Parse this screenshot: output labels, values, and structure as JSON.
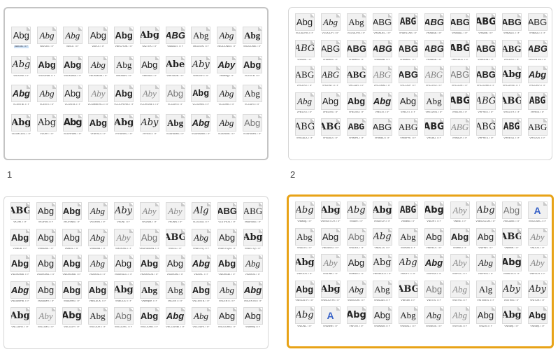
{
  "panels": [
    {
      "id": "1",
      "caption": "1",
      "selection": "gray",
      "rows": [
        [
          {
            "s": "Abg",
            "n": "VAVOB.TTF",
            "st": 0,
            "hl": true
          },
          {
            "s": "Abg",
            "n": "VAVOBI.TTF",
            "st": 2
          },
          {
            "s": "Abg",
            "n": "VAVOI.TTF",
            "st": 2
          },
          {
            "s": "Abg",
            "n": "VAVOI.TTF",
            "st": 0
          },
          {
            "s": "Abg",
            "n": "VBKCHON.TTF",
            "st": 1
          },
          {
            "s": "Abg",
            "n": "VAZTEK.TTF",
            "st": 3
          },
          {
            "s": "ABG",
            "n": "VBANDIT.TTF",
            "st": 7
          },
          {
            "s": "Abg",
            "n": "VBODON.TTF",
            "st": 5
          },
          {
            "s": "Abg",
            "n": "VBODONBI.TTF",
            "st": 2
          },
          {
            "s": "Abg",
            "n": "VBODONB.TTF",
            "st": 10
          }
        ],
        [
          {
            "s": "Abg",
            "n": "VBOONII.TTF",
            "st": 6
          },
          {
            "s": "Abg",
            "n": "VBOONIB.TTF",
            "st": 1
          },
          {
            "s": "Abg",
            "n": "VBOKMAB.TTF",
            "st": 1
          },
          {
            "s": "Abg",
            "n": "VBOKMAIB.TTF",
            "st": 2
          },
          {
            "s": "Abg",
            "n": "VBKMAN.TTF",
            "st": 5
          },
          {
            "s": "Abg",
            "n": "VBKMAI.TTF",
            "st": 0
          },
          {
            "s": "Abe",
            "n": "VBKSADB.TTF",
            "st": 3
          },
          {
            "s": "Aby",
            "n": "VBRUSH.TTF",
            "st": 6
          },
          {
            "s": "Aby",
            "n": "Vbutting.TTF",
            "st": 7
          },
          {
            "s": "Abg",
            "n": "VCENTB.TTF",
            "st": 1
          }
        ],
        [
          {
            "s": "Abg",
            "n": "VCENTBI.TTF",
            "st": 7
          },
          {
            "s": "Abg",
            "n": "VCENTI.TTF",
            "st": 2
          },
          {
            "s": "Abg",
            "n": "VCONTB.TTF",
            "st": 0
          },
          {
            "s": "Aby",
            "n": "VCOMMERCI.TTF",
            "st": 11
          },
          {
            "s": "Abg",
            "n": "VCOOPERB.TTF",
            "st": 1
          },
          {
            "s": "Aby",
            "n": "VCORONET.TTF",
            "st": 11
          },
          {
            "s": "Abg",
            "n": "VCOURI.TTF",
            "st": 12
          },
          {
            "s": "Abg",
            "n": "VCOURBI.TTF",
            "st": 8
          },
          {
            "s": "Abg",
            "n": "VCOURB.TTF",
            "st": 2
          },
          {
            "s": "Abg",
            "n": "VCOURI.TTF",
            "st": 5
          }
        ],
        [
          {
            "s": "Abg",
            "n": "VDOMCASL.TTF",
            "st": 3
          },
          {
            "s": "Abg",
            "n": "VDURY.TTF",
            "st": 13
          },
          {
            "s": "Abg",
            "n": "VDURHAM.TTF",
            "st": 9
          },
          {
            "s": "Abg",
            "n": "VFARSO.TTF",
            "st": 1
          },
          {
            "s": "Abg",
            "n": "VFRANKG.TTF",
            "st": 3
          },
          {
            "s": "Aby",
            "n": "VFREEI.TTF",
            "st": 6
          },
          {
            "s": "Abg",
            "n": "VGARAMB.TTF",
            "st": 10
          },
          {
            "s": "Abg",
            "n": "VGARAMBI.TTF",
            "st": 7
          },
          {
            "s": "Abg",
            "n": "VGARAMI.TTF",
            "st": 2
          },
          {
            "s": "Abg",
            "n": "VGARAMN.TTF",
            "st": 12
          }
        ]
      ]
    },
    {
      "id": "2",
      "caption": "2",
      "selection": "none",
      "rows": [
        [
          {
            "s": "Abg",
            "n": "VGOUDYB.TTF",
            "st": 0
          },
          {
            "s": "Abg",
            "n": "VGOUDYI.TTF",
            "st": 2
          },
          {
            "s": "Abg",
            "n": "VGOUDYN.TTF",
            "st": 5
          },
          {
            "s": "ABG",
            "n": "VHANDEL.TTF",
            "st": 0
          },
          {
            "s": "ABG",
            "n": "VHARLOW.TTF",
            "st": 14
          },
          {
            "s": "ABG",
            "n": "VHABAB.TTF",
            "st": 7
          },
          {
            "s": "ABG",
            "n": "VHABALI.TTF",
            "st": 1
          },
          {
            "s": "ABG",
            "n": "VHABIB.TTF",
            "st": 4
          },
          {
            "s": "ABG",
            "n": "VHBAULI.TTF",
            "st": 1
          },
          {
            "s": "ABG",
            "n": "VHBAULT.TTF",
            "st": 0
          }
        ],
        [
          {
            "s": "ABG",
            "n": "VHABIE.TTF",
            "st": 6
          },
          {
            "s": "ABG",
            "n": "VHAMIN.TTF",
            "st": 0
          },
          {
            "s": "ABG",
            "n": "VHAMIN.TTF",
            "st": 1
          },
          {
            "s": "ABG",
            "n": "VHAMAB.TTF",
            "st": 7
          },
          {
            "s": "ABG",
            "n": "VHAMBC.TTF",
            "st": 1
          },
          {
            "s": "ABG",
            "n": "VHABAB.TTF",
            "st": 7
          },
          {
            "s": "ABG",
            "n": "VHBLACK.TTF",
            "st": 4
          },
          {
            "s": "ABG",
            "n": "VHBODB.TTF",
            "st": 1
          },
          {
            "s": "ABG",
            "n": "VHCENT.TTF",
            "st": 10
          },
          {
            "s": "ABG",
            "n": "VHCENTBI.TTF",
            "st": 7
          }
        ],
        [
          {
            "s": "ABG",
            "n": "VHCENT.TTF",
            "st": 5
          },
          {
            "s": "ABG",
            "n": "VHCENTI.TTF",
            "st": 2
          },
          {
            "s": "ABG",
            "n": "VHCLAR.TTF",
            "st": 10
          },
          {
            "s": "ABG",
            "n": "VHCOMM.TTF",
            "st": 11
          },
          {
            "s": "ABG",
            "n": "VHCOOP.TTF",
            "st": 1
          },
          {
            "s": "ABG",
            "n": "VHCORO.TTF",
            "st": 11
          },
          {
            "s": "ABG",
            "n": "VHCOUR.TTF",
            "st": 12
          },
          {
            "s": "ABG",
            "n": "VHCOURB.TTF",
            "st": 1
          },
          {
            "s": "Abg",
            "n": "VHCURVE.TTF",
            "st": 3
          },
          {
            "s": "Abg",
            "n": "VHCURVI.TTF",
            "st": 7
          }
        ],
        [
          {
            "s": "Abg",
            "n": "VHELVO.TTF",
            "st": 2
          },
          {
            "s": "Abg",
            "n": "VHELVN.TTF",
            "st": 0
          },
          {
            "s": "Abg",
            "n": "VHELVB.TTF",
            "st": 1
          },
          {
            "s": "Abg",
            "n": "VHELVI.TTF",
            "st": 7
          },
          {
            "s": "Abg",
            "n": "VHELVT.TTF",
            "st": 0
          },
          {
            "s": "Abg",
            "n": "VHELVEN.TTF",
            "st": 5
          },
          {
            "s": "ABG",
            "n": "VHELVN.TTF",
            "st": 4
          },
          {
            "s": "ABG",
            "n": "VHFREE.TTF",
            "st": 6
          },
          {
            "s": "ABG",
            "n": "VHGOTH.TTF",
            "st": 3
          },
          {
            "s": "ABG",
            "n": "VHHEB.TTF",
            "st": 14
          }
        ],
        [
          {
            "s": "ABG",
            "n": "VHIGALA.TTF",
            "st": 13
          },
          {
            "s": "ABG",
            "n": "VHIGBO.TTF",
            "st": 3
          },
          {
            "s": "ABG",
            "n": "VHIMPA.TTF",
            "st": 8
          },
          {
            "s": "ABG",
            "n": "VHIMBO.TTF",
            "st": 0
          },
          {
            "s": "ABG",
            "n": "VHIMPRI.TTF",
            "st": 5
          },
          {
            "s": "ABG",
            "n": "VHOBO.TTF",
            "st": 4
          },
          {
            "s": "ABG",
            "n": "VHKAUF.TTF",
            "st": 11
          },
          {
            "s": "ABG",
            "n": "VHPRES.TTF",
            "st": 13
          },
          {
            "s": "ABG",
            "n": "VHRESU.TTF",
            "st": 14
          },
          {
            "s": "ABG",
            "n": "VHSOUV.TTF",
            "st": 5
          }
        ]
      ]
    },
    {
      "id": "3",
      "caption": "",
      "selection": "none",
      "rows": [
        [
          {
            "s": "ABG",
            "n": "VKORI.TTF",
            "st": 3
          },
          {
            "s": "Abg",
            "n": "VKORIN.TTF",
            "st": 0
          },
          {
            "s": "Abg",
            "n": "VKORINB.TTF",
            "st": 1
          },
          {
            "s": "Abg",
            "n": "VKORINI.TTF",
            "st": 2
          },
          {
            "s": "Aby",
            "n": "VKUNI.TTF",
            "st": 6
          },
          {
            "s": "Aby",
            "n": "VKUNIB.TTF",
            "st": 11
          },
          {
            "s": "Aby",
            "n": "VKUNN.TTF",
            "st": 11
          },
          {
            "s": "Alg",
            "n": "VLUCIDA.TTF",
            "st": 6
          },
          {
            "s": "ABG",
            "n": "VLUTHOS.TTF",
            "st": 1
          },
          {
            "s": "ABG",
            "n": "VMARIAB.TTF",
            "st": 5
          }
        ],
        [
          {
            "s": "Abg",
            "n": "VMBUB.TTF",
            "st": 1
          },
          {
            "s": "Abg",
            "n": "VMBUBE.TTF",
            "st": 0
          },
          {
            "s": "Abg",
            "n": "VMBUL.TTF",
            "st": 0
          },
          {
            "s": "Abg",
            "n": "VMBUBB.TTF",
            "st": 2
          },
          {
            "s": "Aby",
            "n": "VMURAN.TTF",
            "st": 11
          },
          {
            "s": "Abg",
            "n": "VMURAMAN.TTF",
            "st": 12
          },
          {
            "s": "ABG",
            "n": "VNIGG.TTF",
            "st": 3
          },
          {
            "s": "Abg",
            "n": "VNASTIQ.TTF",
            "st": 2
          },
          {
            "s": "Abg",
            "n": "VNASTIQB.TTF",
            "st": 0
          },
          {
            "s": "Abg",
            "n": "VNASTIQ.TTF",
            "st": 3
          }
        ],
        [
          {
            "s": "Abg",
            "n": "VNAIRAMB.TTF",
            "st": 1
          },
          {
            "s": "Abg",
            "n": "VNAIRAML.TTF",
            "st": 0
          },
          {
            "s": "Abg",
            "n": "VNAIRAMB.TTF",
            "st": 1
          },
          {
            "s": "Abg",
            "n": "VNAIRALI.TTF",
            "st": 2
          },
          {
            "s": "Abg",
            "n": "VNAIRALO.TTF",
            "st": 0
          },
          {
            "s": "Abg",
            "n": "VNAIRAOB.TTF",
            "st": 1
          },
          {
            "s": "Abg",
            "n": "VNAIRAM.TTF",
            "st": 0
          },
          {
            "s": "Abg",
            "n": "VNAIRL.TTF",
            "st": 7
          },
          {
            "s": "Abg",
            "n": "VNAIRABI.TTF",
            "st": 1
          },
          {
            "s": "Abg",
            "n": "VNAIRAI.TTF",
            "st": 2
          }
        ],
        [
          {
            "s": "Abg",
            "n": "VNAIAMHB.TTF",
            "st": 7
          },
          {
            "s": "Abg",
            "n": "VNAIAMH.TTF",
            "st": 0
          },
          {
            "s": "Abg",
            "n": "VNAIAHB.TTF",
            "st": 1
          },
          {
            "s": "Abg",
            "n": "VNBLACK.TTF",
            "st": 1
          },
          {
            "s": "Abg",
            "n": "VNBODO.TTF",
            "st": 3
          },
          {
            "s": "Abg",
            "n": "VNbrique.TTF",
            "st": 10
          },
          {
            "s": "Abg",
            "n": "VNCENT.TTF",
            "st": 5
          },
          {
            "s": "Abg",
            "n": "VNCENTB.TTF",
            "st": 1
          },
          {
            "s": "Abg",
            "n": "VNCENTI.TTF",
            "st": 2
          },
          {
            "s": "Abg",
            "n": "VNCENTBI.TTF",
            "st": 7
          }
        ],
        [
          {
            "s": "Abg",
            "n": "VNCLARE.TTF",
            "st": 3
          },
          {
            "s": "Aby",
            "n": "VNCOMS.TTF",
            "st": 11
          },
          {
            "s": "Abg",
            "n": "VNCOOP.TTF",
            "st": 4
          },
          {
            "s": "Abg",
            "n": "VNCOUR.TTF",
            "st": 5
          },
          {
            "s": "Abg",
            "n": "VNCOURL.TTF",
            "st": 12
          },
          {
            "s": "Abg",
            "n": "VNCOURB.TTF",
            "st": 1
          },
          {
            "s": "Abg",
            "n": "VNCOURBI.TTF",
            "st": 7
          },
          {
            "s": "Abg",
            "n": "VNCOURI.TTF",
            "st": 2
          },
          {
            "s": "Abg",
            "n": "VNCOURB.TTF",
            "st": 0
          },
          {
            "s": "Abg",
            "n": "VNdmny.TTF",
            "st": 0
          }
        ]
      ]
    },
    {
      "id": "4",
      "caption": "",
      "selection": "orange",
      "rows": [
        [
          {
            "s": "Abg",
            "n": "Vnitalog.TTF",
            "st": 6
          },
          {
            "s": "Abg",
            "n": "VNISKETCH.TTF",
            "st": 3
          },
          {
            "s": "Abg",
            "n": "VNIAIR.TTF",
            "st": 6
          },
          {
            "s": "Abg",
            "n": "VNIDECH.TTF",
            "st": 3
          },
          {
            "s": "ABG",
            "n": "VNIdisk.TTF",
            "st": 14
          },
          {
            "s": "Abg",
            "n": "VNIDHT.TTF",
            "st": 4
          },
          {
            "s": "Aby",
            "n": "VNIBE.TTF",
            "st": 11
          },
          {
            "s": "Abg",
            "n": "VNIBOLLON.TTF",
            "st": 6
          },
          {
            "s": "Abg",
            "n": "VNICAME.TTF",
            "st": 12
          },
          {
            "s": "A",
            "n": "VNICOMIC.TTF",
            "st": 15
          }
        ],
        [
          {
            "s": "Abg",
            "n": "VNIDOS.TTF",
            "st": 5
          },
          {
            "s": "Abg",
            "n": "VNIDAVID.TTF",
            "st": 0
          },
          {
            "s": "Abg",
            "n": "VNIDEA.TTF",
            "st": 12
          },
          {
            "s": "Abg",
            "n": "VNIALLS.TTF",
            "st": 6
          },
          {
            "s": "Abg",
            "n": "VNIHAN.TTF",
            "st": 5
          },
          {
            "s": "Abg",
            "n": "VNIHELV.TTF",
            "st": 0
          },
          {
            "s": "Abg",
            "n": "VNIHIB.TTF",
            "st": 1
          },
          {
            "s": "Abg",
            "n": "VNIHNV.TTF",
            "st": 0
          },
          {
            "s": "ABG",
            "n": "VNIbriet.TTF",
            "st": 3
          },
          {
            "s": "Aby",
            "n": "VNIJOE.TTF",
            "st": 11
          }
        ],
        [
          {
            "s": "Abg",
            "n": "VNIKIOS.TTF",
            "st": 3
          },
          {
            "s": "Aby",
            "n": "VNILINK.TTF",
            "st": 11
          },
          {
            "s": "Abg",
            "n": "VNIMUS.TTF",
            "st": 0
          },
          {
            "s": "Abg",
            "n": "VNIRBOLO.TTF",
            "st": 13
          },
          {
            "s": "Abg",
            "n": "VNIOPTI.TTF",
            "st": 6
          },
          {
            "s": "Abg",
            "n": "VNIPISA.TTF",
            "st": 7
          },
          {
            "s": "Aby",
            "n": "VNIPOC.TTF",
            "st": 11
          },
          {
            "s": "Abg",
            "n": "VNIPRIS.TTF",
            "st": 2
          },
          {
            "s": "Abg",
            "n": "VNIREVO.TTF",
            "st": 4
          },
          {
            "s": "Aby",
            "n": "VNIRICH.TTF",
            "st": 11
          }
        ],
        [
          {
            "s": "Abg",
            "n": "VNISOUTH.TTF",
            "st": 1
          },
          {
            "s": "Abg",
            "n": "VNISOUTHI.TTF",
            "st": 3
          },
          {
            "s": "Abg",
            "n": "VNISOURI.TTF",
            "st": 2
          },
          {
            "s": "Abg",
            "n": "VNISUAS.TTF",
            "st": 5
          },
          {
            "s": "ABG",
            "n": "VNISWI.TTF",
            "st": 3
          },
          {
            "s": "Abg",
            "n": "VNITES.TTF",
            "st": 12
          },
          {
            "s": "Abg",
            "n": "VNITHO.TTF",
            "st": 11
          },
          {
            "s": "Alg",
            "n": "VNITIMES.TTF",
            "st": 5
          },
          {
            "s": "Aby",
            "n": "VNITRIB.TTF",
            "st": 6
          },
          {
            "s": "Aby",
            "n": "VNITUR.TTF",
            "st": 6
          }
        ],
        [
          {
            "s": "Abg",
            "n": "VNIUNL.TTF",
            "st": 6
          },
          {
            "s": "A",
            "n": "VNIvarle.TTF",
            "st": 15
          },
          {
            "s": "Abg",
            "n": "VNIVIVI.TTF",
            "st": 4
          },
          {
            "s": "Abg",
            "n": "VNIWAIM.TTF",
            "st": 0
          },
          {
            "s": "Abg",
            "n": "VNIWALT.TTF",
            "st": 5
          },
          {
            "s": "Abg",
            "n": "VNIWIDE.TTF",
            "st": 2
          },
          {
            "s": "Abg",
            "n": "VNIYOB.TTF",
            "st": 11
          },
          {
            "s": "Abg",
            "n": "VNIZIN.TTF",
            "st": 0
          },
          {
            "s": "Abg",
            "n": "VNIvarp.TTF",
            "st": 3
          },
          {
            "s": "Abg",
            "n": "VNIvarp.TTF",
            "st": 1
          }
        ]
      ]
    }
  ]
}
